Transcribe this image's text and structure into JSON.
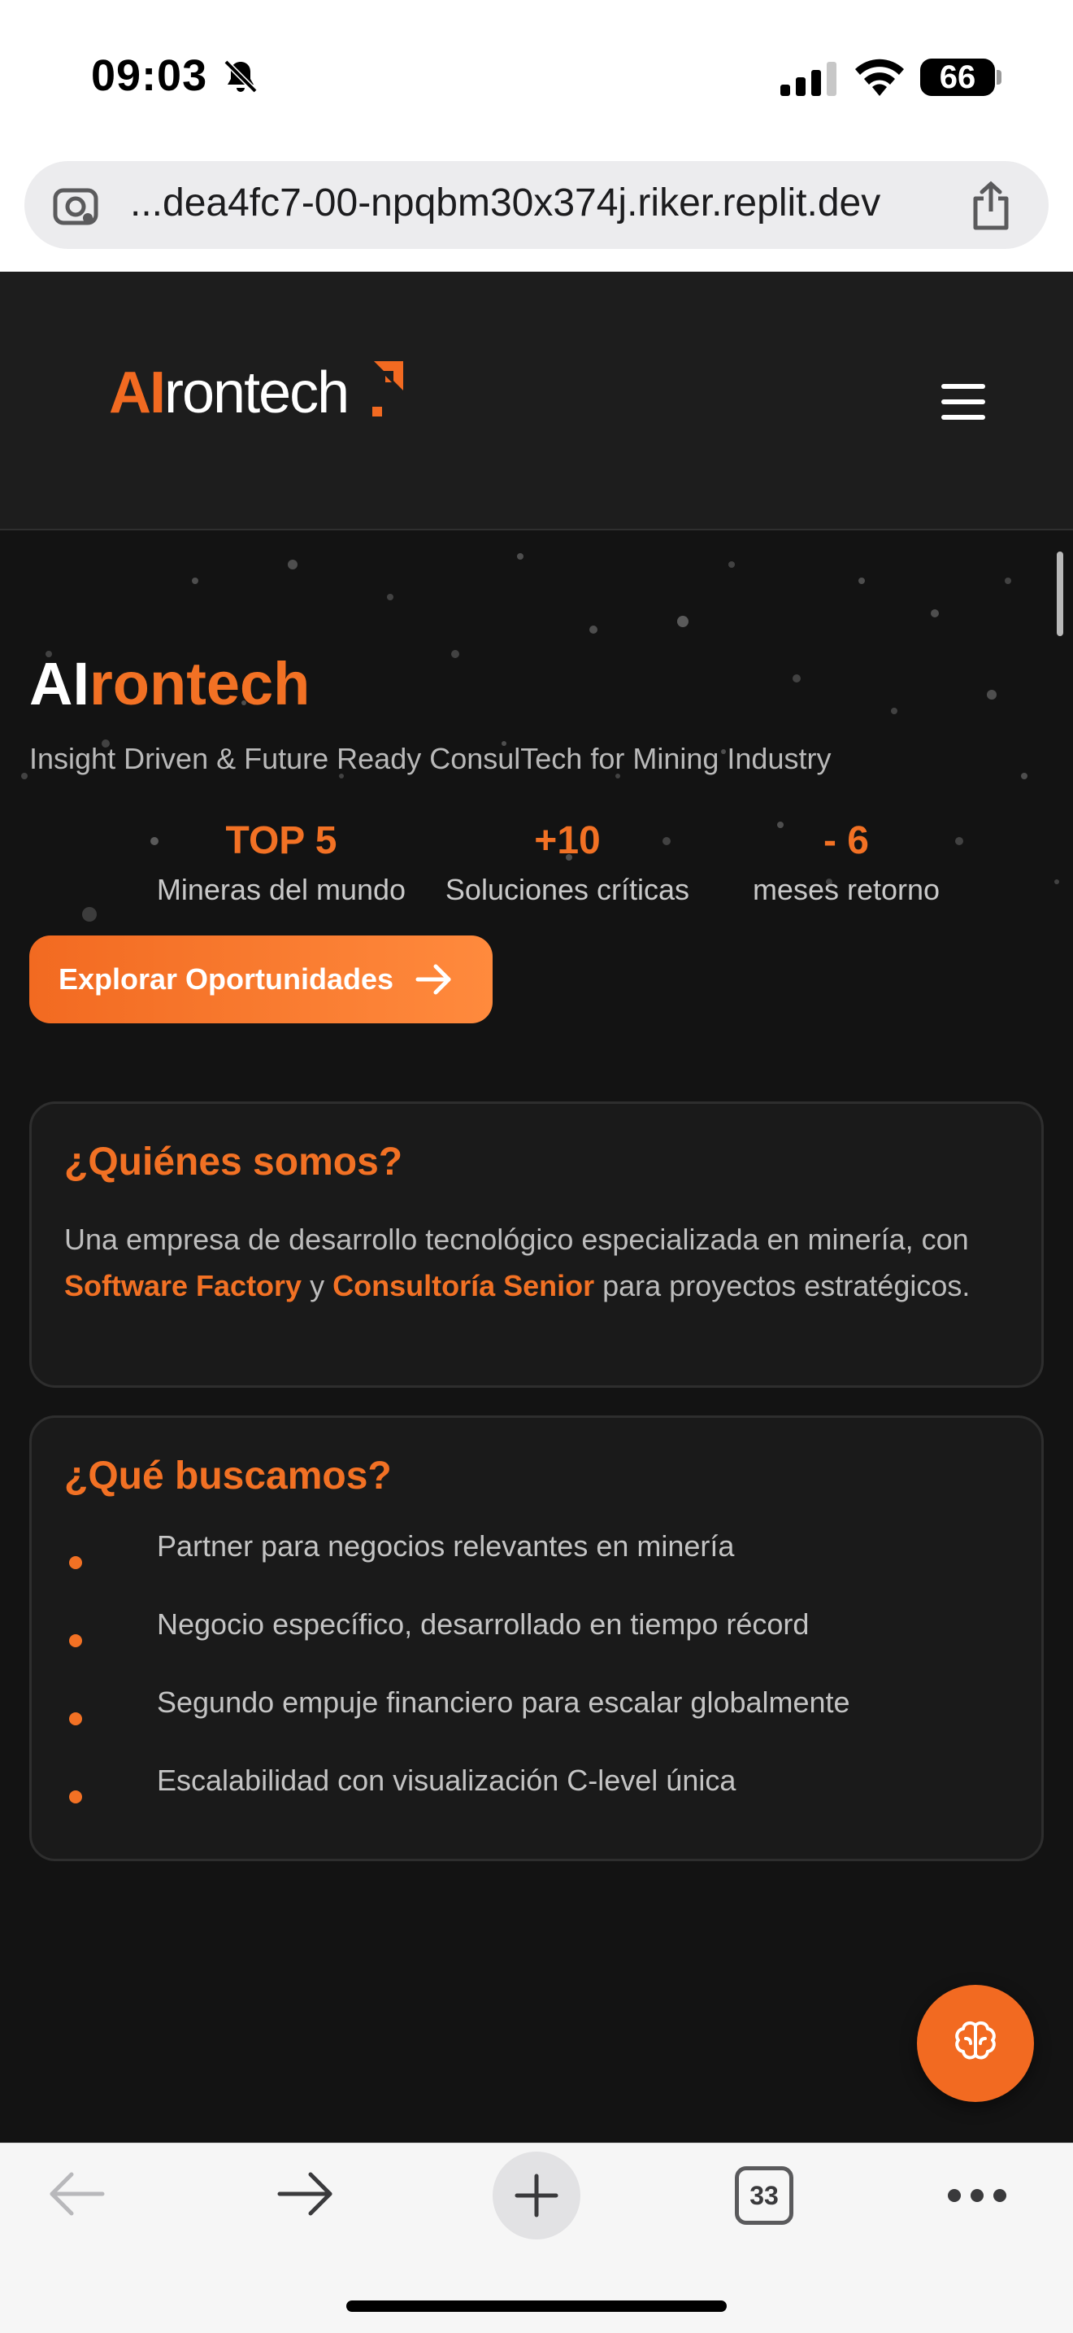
{
  "status_bar": {
    "time": "09:03",
    "battery": "66",
    "icons": [
      "bell-slash-icon",
      "cellular-signal-icon",
      "wifi-icon",
      "battery-icon"
    ]
  },
  "browser": {
    "url": "...dea4fc7-00-npqbm30x374j.riker.replit.dev",
    "icons": [
      "page-settings-icon",
      "share-icon"
    ],
    "toolbar": {
      "tab_count": "33",
      "icons": [
        "back-arrow-icon",
        "forward-arrow-icon",
        "plus-icon",
        "tabs-icon",
        "more-icon"
      ]
    }
  },
  "site": {
    "logo": {
      "ai": "AI",
      "rest": "rontech"
    },
    "header_icons": [
      "menu-icon"
    ],
    "hero": {
      "title_prefix": "AI",
      "title_accent": "rontech",
      "subtitle": "Insight Driven & Future Ready ConsulTech for Mining Industry",
      "stats": [
        {
          "value": "TOP 5",
          "label": "Mineras del mundo"
        },
        {
          "value": "+10",
          "label": "Soluciones críticas"
        },
        {
          "value": "- 6",
          "label": "meses retorno"
        }
      ],
      "cta_label": "Explorar Oportunidades",
      "cta_icon": "arrow-right-icon"
    },
    "about": {
      "title": "¿Quiénes somos?",
      "text_1": "Una empresa de desarrollo tecnológico especializada en minería, con ",
      "highlight_1": "Software Factory",
      "text_2": " y ",
      "highlight_2": "Consultoría Senior",
      "text_3": " para proyectos estratégicos."
    },
    "seeking": {
      "title": "¿Qué buscamos?",
      "items": [
        "Partner para negocios relevantes en minería",
        "Negocio específico, desarrollado en tiempo récord",
        "Segundo empuje financiero para escalar globalmente",
        "Escalabilidad con visualización C-level única"
      ]
    },
    "fab_icon": "brain-icon",
    "colors": {
      "accent": "#f27124",
      "background": "#131313",
      "card": "#1a1a1a"
    }
  }
}
